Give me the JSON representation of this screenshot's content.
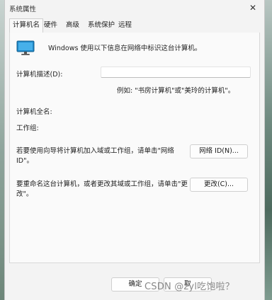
{
  "window": {
    "title": "系统属性",
    "close_glyph": "✕"
  },
  "tabs": [
    {
      "label": "计算机名",
      "active": true
    },
    {
      "label": "硬件",
      "active": false
    },
    {
      "label": "高级",
      "active": false
    },
    {
      "label": "系统保护",
      "active": false
    },
    {
      "label": "远程",
      "active": false
    }
  ],
  "panel": {
    "intro_text": "Windows 使用以下信息在网络中标识这台计算机。",
    "description_label": "计算机描述(D):",
    "description_value": "",
    "description_example": "例如: \"书房计算机\"或\"美玲的计算机\"。",
    "full_name_label": "计算机全名:",
    "workgroup_label": "工作组:",
    "network_id_text": "若要使用向导将计算机加入域或工作组，请单击\"网络\nID\"。",
    "network_id_line1": "若要使用向导将计算机加入域或工作组，请单击\"网络",
    "network_id_line2": "ID\"。",
    "network_id_button": "网络 ID(N)...",
    "rename_line1": "要重命名这台计算机，或者更改其域或工作组，请单击\"更",
    "rename_line2": "改\"。",
    "change_button": "更改(C)..."
  },
  "footer": {
    "ok_button": "确定",
    "cancel_button": "取"
  },
  "watermark": "CSDN @zyl吃饱啦？",
  "colors": {
    "window_bg": "#f3f3f3",
    "panel_bg": "#fafafa",
    "monitor_blue": "#1e88c8"
  },
  "icons": {
    "monitor": "monitor-icon",
    "close": "close-icon"
  }
}
